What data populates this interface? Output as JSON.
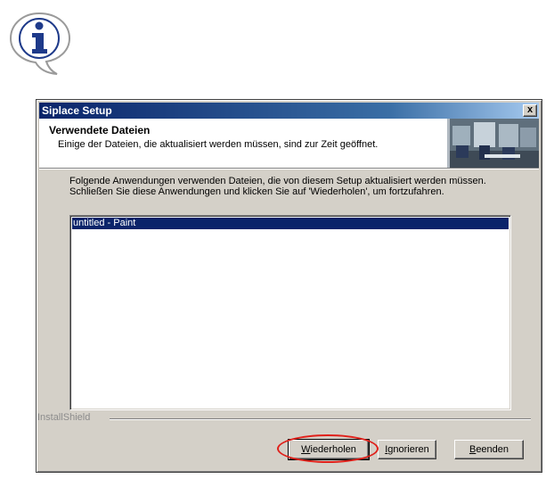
{
  "dialog": {
    "title": "Siplace Setup",
    "close_label": "x",
    "header": {
      "title": "Verwendete Dateien",
      "subtitle": "Einige der Dateien, die aktualisiert werden müssen, sind zur Zeit geöffnet."
    },
    "body_text": "Folgende Anwendungen verwenden Dateien, die von diesem Setup aktualisiert werden müssen. Schließen Sie diese Anwendungen und klicken Sie auf 'Wiederholen', um fortzufahren.",
    "list_items": [
      "untitled - Paint"
    ],
    "brand": "InstallShield",
    "buttons": {
      "retry_prefix": "W",
      "retry_rest": "iederholen",
      "ignore_prefix": "I",
      "ignore_rest": "gnorieren",
      "cancel_prefix": "B",
      "cancel_rest": "eenden"
    }
  },
  "colors": {
    "titlebar_start": "#0a246a",
    "selection": "#0a246a",
    "face": "#d4d0c8",
    "highlight_ring": "#e0201a"
  },
  "icons": {
    "callout": "info-icon",
    "close": "close-icon"
  }
}
